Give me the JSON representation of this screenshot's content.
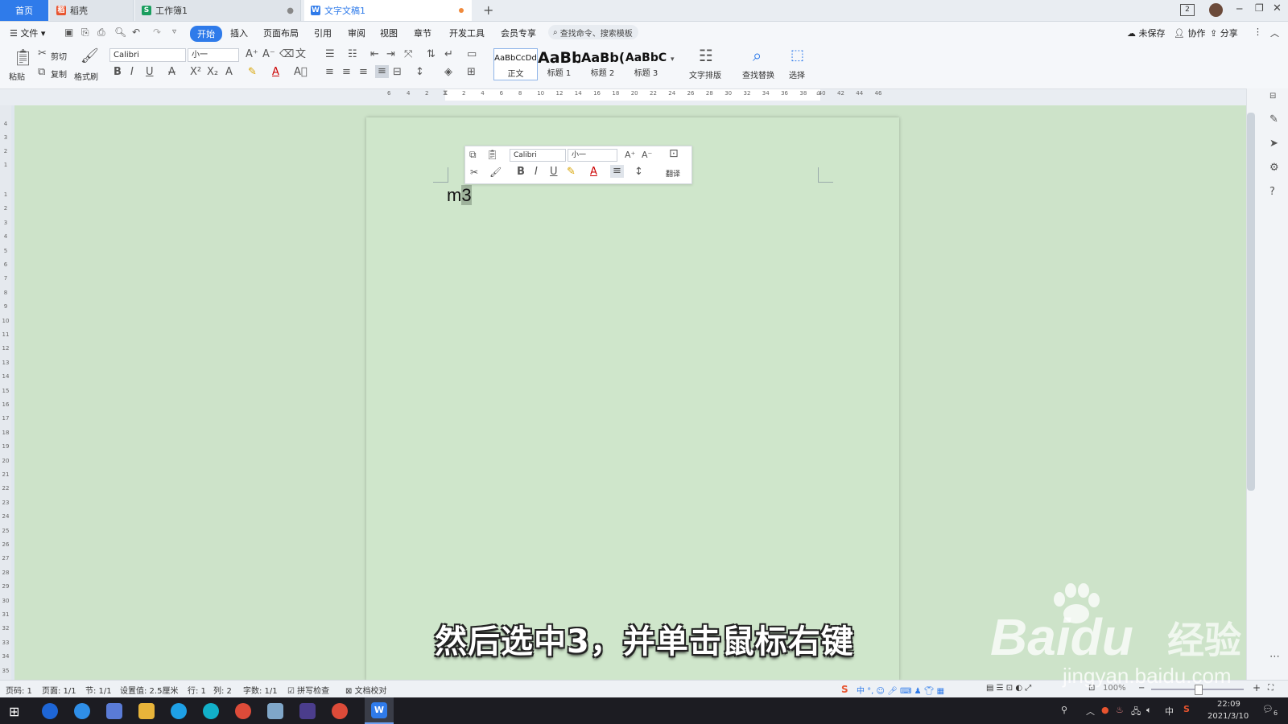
{
  "tabs": [
    {
      "label": "首页"
    },
    {
      "label": "稻壳"
    },
    {
      "label": "工作簿1"
    },
    {
      "label": "文字文稿1"
    }
  ],
  "menu": {
    "file": "文件",
    "items": [
      "开始",
      "插入",
      "页面布局",
      "引用",
      "审阅",
      "视图",
      "章节",
      "开发工具",
      "会员专享"
    ],
    "search_placeholder": "查找命令、搜索模板",
    "unsaved": "未保存",
    "collab": "协作",
    "share": "分享"
  },
  "ribbon": {
    "paste": "粘贴",
    "cut": "剪切",
    "copy": "复制",
    "format_painter": "格式刷",
    "font_name": "Calibri",
    "font_size": "小一",
    "styles": [
      {
        "sample": "AaBbCcDd",
        "name": "正文"
      },
      {
        "sample": "AaBb",
        "name": "标题 1"
      },
      {
        "sample": "AaBb(",
        "name": "标题 2"
      },
      {
        "sample": "AaBbC",
        "name": "标题 3"
      }
    ],
    "text_layout": "文字排版",
    "find_replace": "查找替换",
    "select": "选择"
  },
  "ruler": {
    "h_left": [
      "6",
      "4",
      "2"
    ],
    "h_right": [
      "2",
      "4",
      "6",
      "8",
      "10",
      "12",
      "14",
      "16",
      "18",
      "20",
      "22",
      "24",
      "26",
      "28",
      "30",
      "32",
      "34",
      "36",
      "38",
      "40",
      "42",
      "44",
      "46"
    ],
    "v_top": [
      "4",
      "3",
      "2",
      "1"
    ],
    "v_main": [
      "1",
      "2",
      "3",
      "4",
      "5",
      "6",
      "7",
      "8",
      "9",
      "10",
      "11",
      "12",
      "13",
      "14",
      "15",
      "16",
      "17",
      "18",
      "19",
      "20",
      "21",
      "22",
      "23",
      "24",
      "25",
      "26",
      "27",
      "28",
      "29",
      "30",
      "31",
      "32",
      "33",
      "34",
      "35"
    ]
  },
  "mini_toolbar": {
    "font_name": "Calibri",
    "font_size": "小一",
    "translate": "翻译"
  },
  "document": {
    "text_before": "m",
    "text_selected": "3"
  },
  "status": {
    "page_num": "页码: 1",
    "pages": "页面: 1/1",
    "section": "节: 1/1",
    "setting": "设置值: 2.5厘米",
    "row": "行: 1",
    "col": "列: 2",
    "words": "字数: 1/1",
    "spell": "拼写检查",
    "proof": "文档校对",
    "zoom": "100%"
  },
  "taskbar": {
    "time": "22:09",
    "date": "2021/3/10",
    "ime": "中",
    "notif_count": "6"
  },
  "subtitle": "然后选中3，并单击鼠标右键",
  "watermark": {
    "brand": "Baidu",
    "brand_cn": "经验",
    "url": "jingyan.baidu.com"
  },
  "colors": {
    "accent": "#2f7bea",
    "canvas": "#cde3c9",
    "selection": "#9fb39c"
  }
}
